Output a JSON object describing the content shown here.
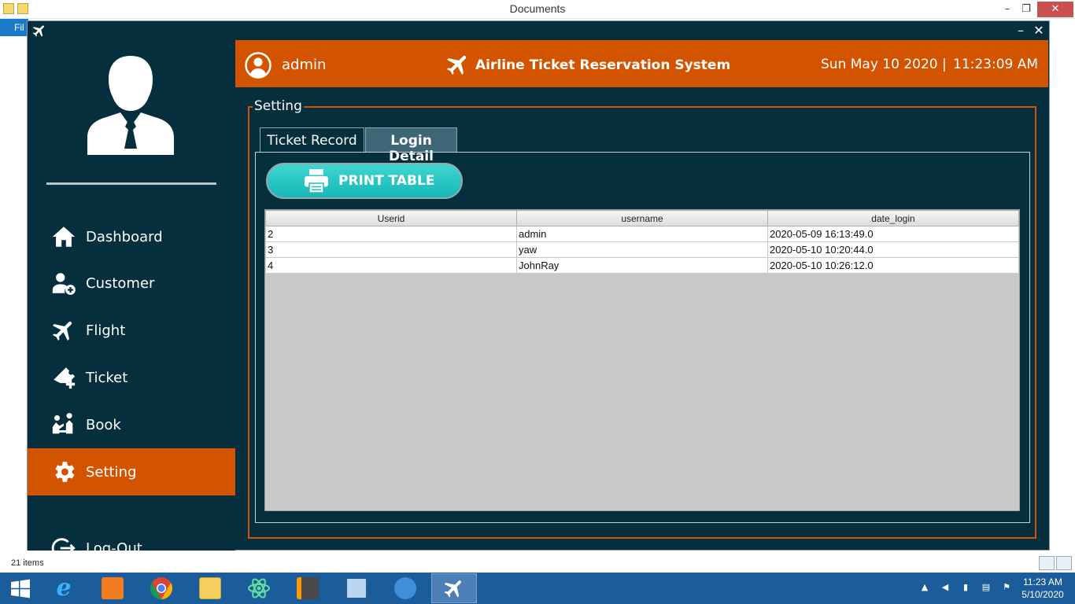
{
  "explorer": {
    "title": "Documents",
    "ribbon_tab": "Fil",
    "status_items": "21 items",
    "minimize": "–",
    "restore": "❐",
    "close": "✕"
  },
  "app": {
    "minimize": "–",
    "close": "✕"
  },
  "header": {
    "user_name": "admin",
    "title": "Airline Ticket Reservation System",
    "date": "Sun May 10 2020 |",
    "time": "11:23:09 AM"
  },
  "sidebar": {
    "items": [
      {
        "label": "Dashboard",
        "icon": "home-icon"
      },
      {
        "label": "Customer",
        "icon": "user-add-icon"
      },
      {
        "label": "Flight",
        "icon": "plane-icon"
      },
      {
        "label": "Ticket",
        "icon": "ticket-icon"
      },
      {
        "label": "Book",
        "icon": "book-icon"
      },
      {
        "label": "Setting",
        "icon": "gear-icon",
        "active": true
      },
      {
        "label": "Log-Out",
        "icon": "logout-icon"
      }
    ]
  },
  "setting": {
    "legend": "Setting",
    "tabs": [
      "Ticket Record",
      "Login Detail"
    ],
    "active_tab": "Login Detail",
    "print_button": "PRINT TABLE",
    "table": {
      "columns": [
        "Userid",
        "username",
        "date_login"
      ],
      "rows": [
        [
          "2",
          "admin",
          "2020-05-09 16:13:49.0"
        ],
        [
          "3",
          "yaw",
          "2020-05-10 10:20:44.0"
        ],
        [
          "4",
          "JohnRay",
          "2020-05-10 10:26:12.0"
        ]
      ]
    }
  },
  "taskbar": {
    "time": "11:23 AM",
    "date": "5/10/2020"
  },
  "colors": {
    "accent": "#d35400",
    "background": "#062f3e",
    "button": "#1dbfbd"
  }
}
